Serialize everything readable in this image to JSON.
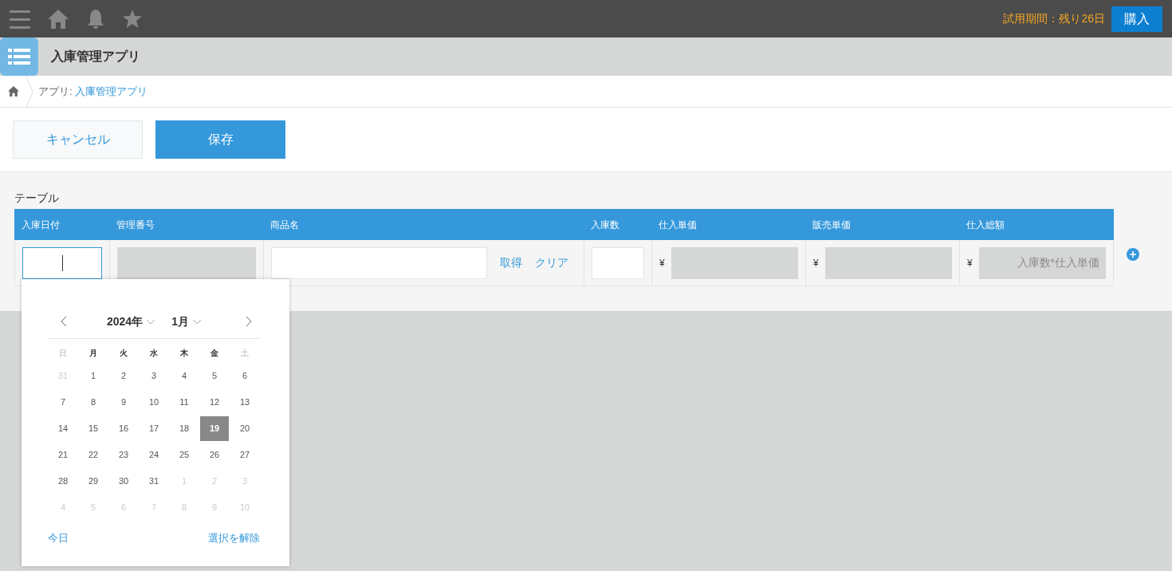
{
  "topbar": {
    "trial": "試用期間：残り26日",
    "buy_button": "購入"
  },
  "app": {
    "title": "入庫管理アプリ"
  },
  "breadcrumb": {
    "prefix": "アプリ: ",
    "link": "入庫管理アプリ"
  },
  "actions": {
    "cancel": "キャンセル",
    "save": "保存"
  },
  "table": {
    "label": "テーブル",
    "columns": [
      "入庫日付",
      "管理番号",
      "商品名",
      "入庫数",
      "仕入単価",
      "販売単価",
      "仕入総額"
    ],
    "row": [
      {
        "kind": "date"
      },
      {
        "kind": "readonly"
      },
      {
        "kind": "lookup",
        "actions": [
          "取得",
          "クリア"
        ]
      },
      {
        "kind": "number"
      },
      {
        "kind": "currency",
        "symbol": "¥"
      },
      {
        "kind": "currency",
        "symbol": "¥"
      },
      {
        "kind": "currency",
        "symbol": "¥",
        "placeholder": "入庫数*仕入単価"
      }
    ]
  },
  "calendar": {
    "year": "2024年",
    "month": "1月",
    "weekdays": [
      {
        "label": "日",
        "muted": true
      },
      {
        "label": "月",
        "muted": false
      },
      {
        "label": "火",
        "muted": false
      },
      {
        "label": "水",
        "muted": false
      },
      {
        "label": "木",
        "muted": false
      },
      {
        "label": "金",
        "muted": false
      },
      {
        "label": "土",
        "muted": true
      }
    ],
    "weeks": [
      [
        {
          "label": "31",
          "outside": true,
          "selected": false
        },
        {
          "label": "1",
          "outside": false,
          "selected": false
        },
        {
          "label": "2",
          "outside": false,
          "selected": false
        },
        {
          "label": "3",
          "outside": false,
          "selected": false
        },
        {
          "label": "4",
          "outside": false,
          "selected": false
        },
        {
          "label": "5",
          "outside": false,
          "selected": false
        },
        {
          "label": "6",
          "outside": false,
          "selected": false
        }
      ],
      [
        {
          "label": "7",
          "outside": false,
          "selected": false
        },
        {
          "label": "8",
          "outside": false,
          "selected": false
        },
        {
          "label": "9",
          "outside": false,
          "selected": false
        },
        {
          "label": "10",
          "outside": false,
          "selected": false
        },
        {
          "label": "11",
          "outside": false,
          "selected": false
        },
        {
          "label": "12",
          "outside": false,
          "selected": false
        },
        {
          "label": "13",
          "outside": false,
          "selected": false
        }
      ],
      [
        {
          "label": "14",
          "outside": false,
          "selected": false
        },
        {
          "label": "15",
          "outside": false,
          "selected": false
        },
        {
          "label": "16",
          "outside": false,
          "selected": false
        },
        {
          "label": "17",
          "outside": false,
          "selected": false
        },
        {
          "label": "18",
          "outside": false,
          "selected": false
        },
        {
          "label": "19",
          "outside": false,
          "selected": true
        },
        {
          "label": "20",
          "outside": false,
          "selected": false
        }
      ],
      [
        {
          "label": "21",
          "outside": false,
          "selected": false
        },
        {
          "label": "22",
          "outside": false,
          "selected": false
        },
        {
          "label": "23",
          "outside": false,
          "selected": false
        },
        {
          "label": "24",
          "outside": false,
          "selected": false
        },
        {
          "label": "25",
          "outside": false,
          "selected": false
        },
        {
          "label": "26",
          "outside": false,
          "selected": false
        },
        {
          "label": "27",
          "outside": false,
          "selected": false
        }
      ],
      [
        {
          "label": "28",
          "outside": false,
          "selected": false
        },
        {
          "label": "29",
          "outside": false,
          "selected": false
        },
        {
          "label": "30",
          "outside": false,
          "selected": false
        },
        {
          "label": "31",
          "outside": false,
          "selected": false
        },
        {
          "label": "1",
          "outside": true,
          "selected": false
        },
        {
          "label": "2",
          "outside": true,
          "selected": false
        },
        {
          "label": "3",
          "outside": true,
          "selected": false
        }
      ],
      [
        {
          "label": "4",
          "outside": true,
          "selected": false
        },
        {
          "label": "5",
          "outside": true,
          "selected": false
        },
        {
          "label": "6",
          "outside": true,
          "selected": false
        },
        {
          "label": "7",
          "outside": true,
          "selected": false
        },
        {
          "label": "8",
          "outside": true,
          "selected": false
        },
        {
          "label": "9",
          "outside": true,
          "selected": false
        },
        {
          "label": "10",
          "outside": true,
          "selected": false
        }
      ]
    ],
    "today": "今日",
    "clear": "選択を解除"
  }
}
